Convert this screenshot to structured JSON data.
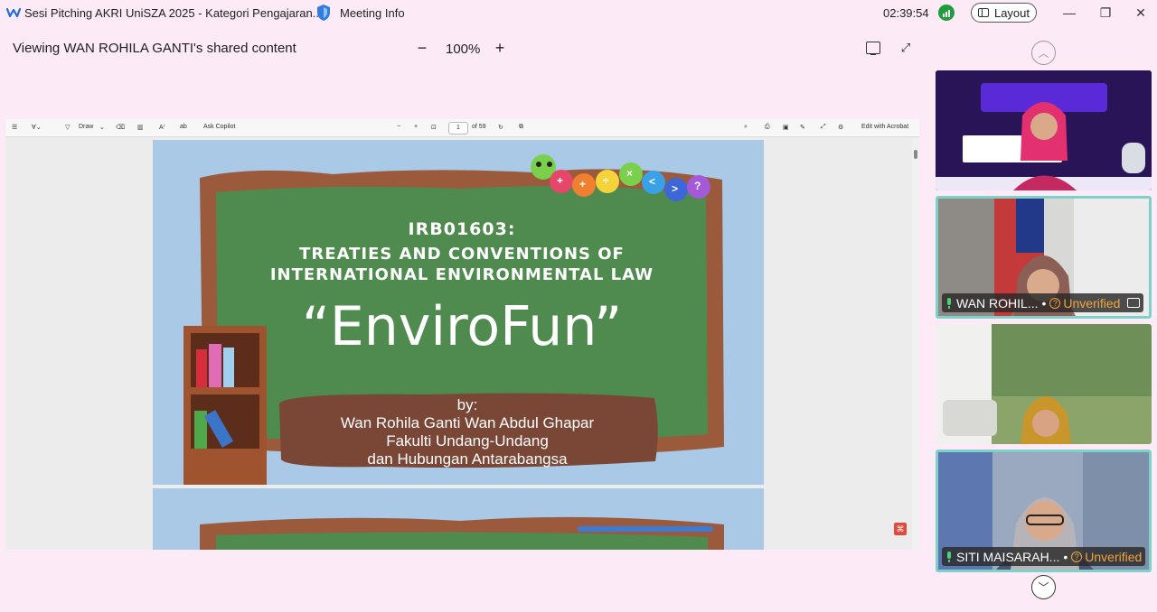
{
  "window": {
    "title": "Sesi Pitching AKRI UniSZA 2025 - Kategori Pengajaran...",
    "meeting_info": "Meeting Info",
    "clock": "02:39:54",
    "layout_label": "Layout",
    "icons": [
      "webex-icon",
      "shield-icon",
      "signal-icon",
      "layout-icon",
      "minimize-icon",
      "restore-icon",
      "close-icon"
    ]
  },
  "viewer": {
    "viewing_text": "Viewing WAN ROHILA GANTI's shared content",
    "zoom_minus": "−",
    "zoom_level": "100%",
    "zoom_plus": "+"
  },
  "pdf_toolbar": {
    "draw_label": "Draw",
    "ask_copilot": "Ask Copilot",
    "page_current": "1",
    "page_total": "of 59",
    "edit_acrobat": "Edit with Acrobat",
    "zoom_out": "−",
    "zoom_in": "+"
  },
  "slide": {
    "code": "IRB01603:",
    "title_line1": "TREATIES AND CONVENTIONS OF",
    "title_line2": "INTERNATIONAL ENVIRONMENTAL LAW",
    "project": "“EnviroFun”",
    "by": "by:",
    "author": "Wan Rohila Ganti Wan Abdul Ghapar",
    "faculty_line1": "Fakulti Undang-Undang",
    "faculty_line2": "dan Hubungan Antarabangsa",
    "caterpillar_symbols": [
      "+",
      "+",
      "÷",
      "×",
      "<",
      ">",
      "?"
    ],
    "colors": {
      "background": "#a9c9e6",
      "board": "#4f8b4f",
      "frame": "#9c5a3c",
      "banner": "#7a4636"
    }
  },
  "gallery": {
    "participants": [
      {
        "name": "WAN ROHIL...",
        "status": "Unverified",
        "sharing": true
      },
      {
        "name": "SITI MAISARAH...",
        "status": "Unverified",
        "sharing": false
      }
    ]
  },
  "colors": {
    "app_background": "#fcebf6",
    "active_tile_border": "#7fd1c7",
    "unverified": "#f3a53a",
    "mic": "#4ad17a"
  }
}
